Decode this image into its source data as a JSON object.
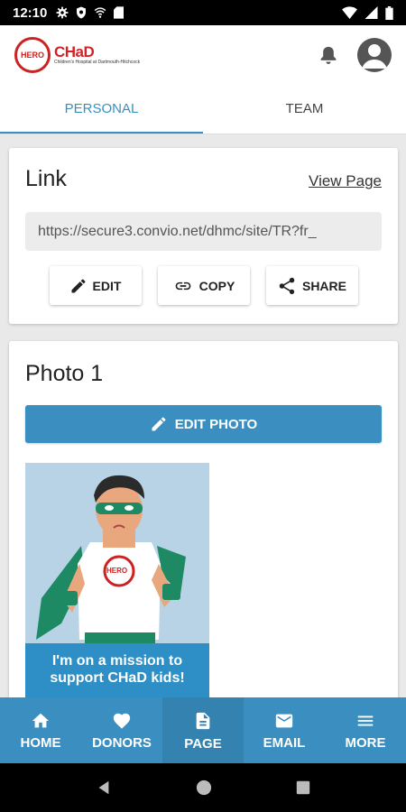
{
  "status_bar": {
    "time": "12:10"
  },
  "header": {
    "logo_badge": "HERO",
    "logo_brand": "CHaD",
    "logo_sub": "Children's Hospital at Dartmouth-Hitchcock"
  },
  "tabs": [
    {
      "label": "PERSONAL"
    },
    {
      "label": "TEAM"
    }
  ],
  "link_card": {
    "title": "Link",
    "view_page": "View Page",
    "url": "https://secure3.convio.net/dhmc/site/TR?fr_",
    "buttons": {
      "edit": "EDIT",
      "copy": "COPY",
      "share": "SHARE"
    }
  },
  "photo_card": {
    "title": "Photo 1",
    "edit_photo": "EDIT PHOTO",
    "badge": "HERO",
    "banner_line1": "I'm on a mission to",
    "banner_line2": "support CHaD kids!"
  },
  "bottom_nav": [
    {
      "label": "HOME",
      "icon": "home-icon"
    },
    {
      "label": "DONORS",
      "icon": "heart-icon"
    },
    {
      "label": "PAGE",
      "icon": "page-icon"
    },
    {
      "label": "EMAIL",
      "icon": "email-icon"
    },
    {
      "label": "MORE",
      "icon": "menu-icon"
    }
  ],
  "colors": {
    "accent": "#3a8fc0",
    "brand_red": "#d62027"
  }
}
